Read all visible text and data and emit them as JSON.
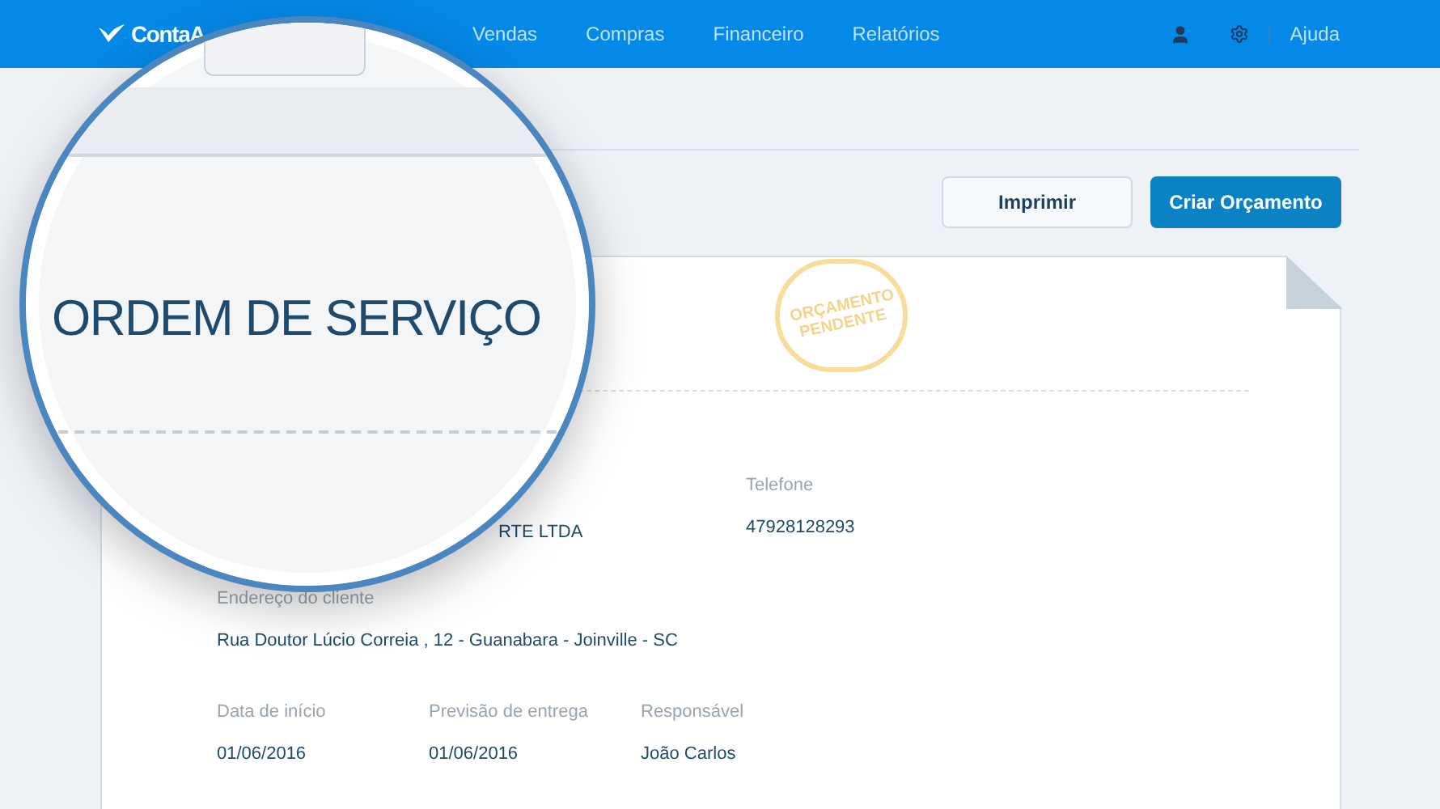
{
  "header": {
    "logo": "ContaA",
    "nav": [
      {
        "label": "Vendas"
      },
      {
        "label": "Compras"
      },
      {
        "label": "Financeiro"
      },
      {
        "label": "Relatórios"
      }
    ],
    "help": "Ajuda"
  },
  "actions": [
    {
      "label": "Imprimir",
      "kind": "secondary"
    },
    {
      "label": "Criar Orçamento",
      "kind": "primary"
    }
  ],
  "document": {
    "stamp": "ORÇAMENTO PENDENTE",
    "client_name_partial": "RTE LTDA",
    "phone": {
      "label": "Telefone",
      "value": "47928128293"
    },
    "address": {
      "label": "Endereço do cliente",
      "value": "Rua Doutor Lúcio Correia , 12 - Guanabara - Joinville - SC"
    },
    "fields": [
      {
        "label": "Data de início",
        "value": "01/06/2016"
      },
      {
        "label": "Previsão de entrega",
        "value": "01/06/2016"
      },
      {
        "label": "Responsável",
        "value": "João Carlos"
      }
    ]
  },
  "magnifier": {
    "title": "ORDEM DE SERVIÇO"
  }
}
